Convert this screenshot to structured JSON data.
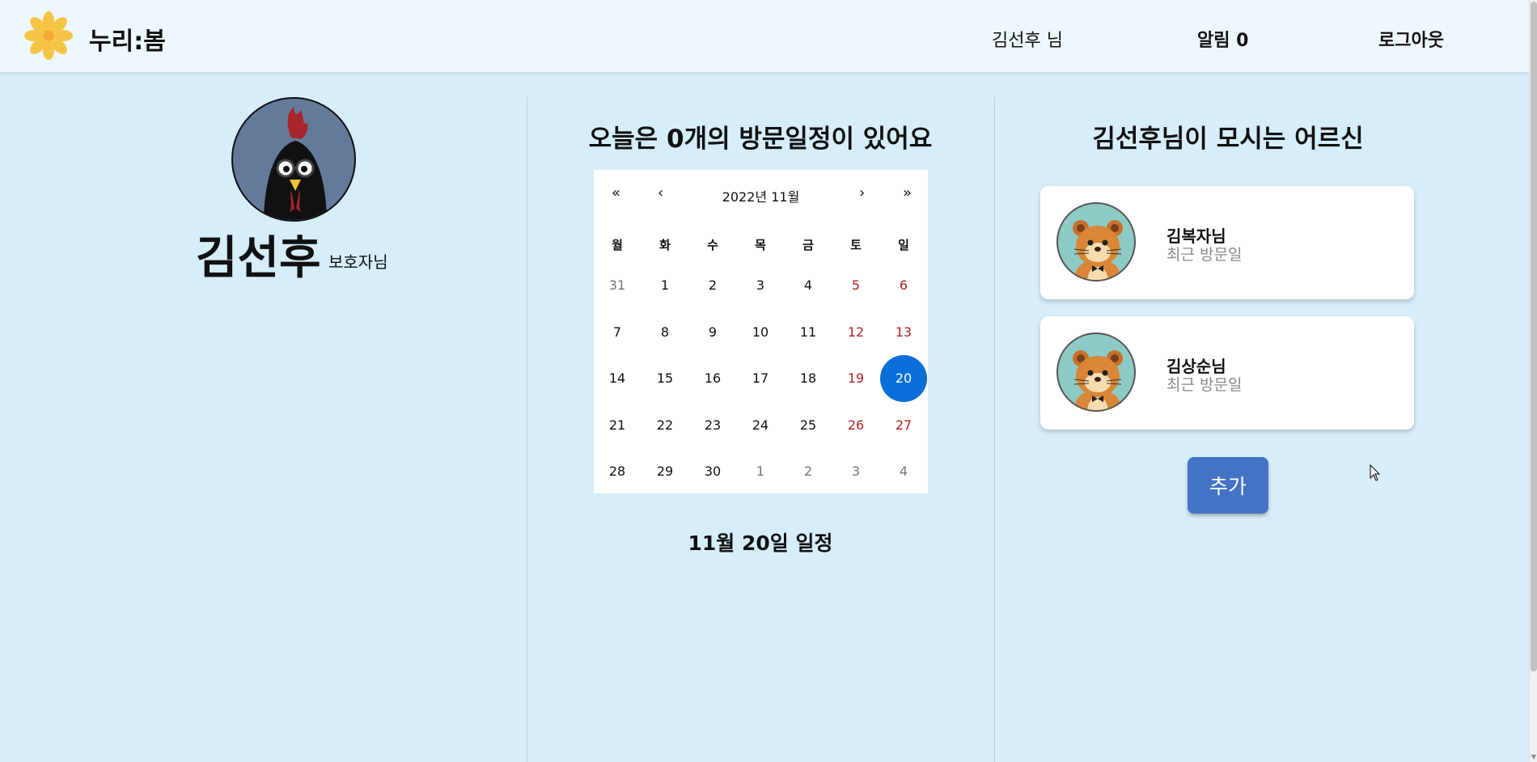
{
  "header": {
    "app_title": "누리:봄",
    "user_name": "김선후",
    "user_suffix": "님",
    "alert_label": "알림 0",
    "logout_label": "로그아웃"
  },
  "profile": {
    "name": "김선후",
    "role": "보호자님"
  },
  "visits": {
    "title": "오늘은 0개의 방문일정이 있어요",
    "schedule_title": "11월 20일 일정"
  },
  "calendar": {
    "month_label": "2022년 11월",
    "nav_prev2": "«",
    "nav_prev": "‹",
    "nav_next": "›",
    "nav_next2": "»",
    "weekdays": [
      "월",
      "화",
      "수",
      "목",
      "금",
      "토",
      "일"
    ],
    "weeks": [
      [
        "31",
        "1",
        "2",
        "3",
        "4",
        "5",
        "6"
      ],
      [
        "7",
        "8",
        "9",
        "10",
        "11",
        "12",
        "13"
      ],
      [
        "14",
        "15",
        "16",
        "17",
        "18",
        "19",
        "20"
      ],
      [
        "21",
        "22",
        "23",
        "24",
        "25",
        "26",
        "27"
      ],
      [
        "28",
        "29",
        "30",
        "1",
        "2",
        "3",
        "4"
      ]
    ],
    "selected_day": "20"
  },
  "elders": {
    "title": "김선후님이 모시는 어르신",
    "items": [
      {
        "name": "김복자님",
        "subtitle": "최근 방문일"
      },
      {
        "name": "김상순님",
        "subtitle": "최근 방문일"
      }
    ],
    "add_label": "추가"
  },
  "colors": {
    "background": "#d6edfa",
    "header": "#eef7fd",
    "selected_day": "#0a6fd8",
    "add_button": "#4472c4",
    "weekend": "#b22222"
  }
}
